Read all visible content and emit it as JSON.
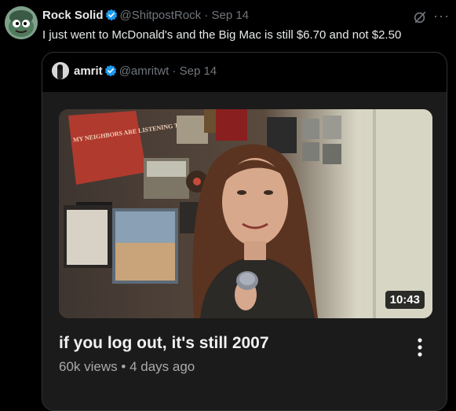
{
  "tweet": {
    "author_name": "Rock Solid",
    "author_handle": "@ShitpostRock",
    "separator": "·",
    "date": "Sep 14",
    "text": "I just went to McDonald's and the Big Mac is still $6.70 and not $2.50"
  },
  "quoted_tweet": {
    "author_name": "amrit",
    "author_handle": "@amritwt",
    "separator": "·",
    "date": "Sep 14",
    "video": {
      "duration": "10:43",
      "title": "if you log out, it's still 2007",
      "views": "60k views",
      "meta_separator": "•",
      "age": "4 days ago",
      "poster_text": "MY NEIGHBORS ARE LISTENING TO GREAT MUSIC"
    }
  },
  "colors": {
    "background": "#000000",
    "verified_blue": "#1d9bf0",
    "muted_text": "#71767b",
    "card_background": "#1b1b1b"
  },
  "icons": [
    "verified-badge-icon",
    "grok-icon",
    "more-options-icon",
    "video-menu-icon"
  ]
}
